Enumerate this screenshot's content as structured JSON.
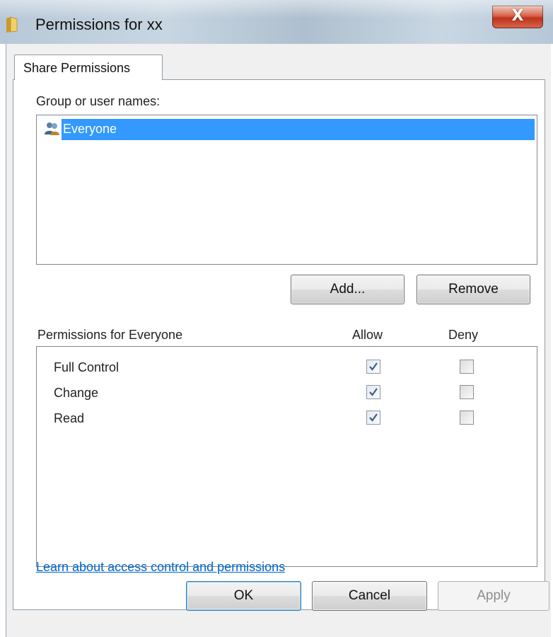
{
  "window": {
    "title": "Permissions for xx",
    "icon": "folder-icon",
    "close_icon": "close-icon",
    "close_label": "X"
  },
  "tabs": [
    {
      "label": "Share Permissions",
      "selected": true
    }
  ],
  "group_section": {
    "label": "Group or user names:",
    "items": [
      {
        "name": "Everyone",
        "icon": "users-icon",
        "selected": true
      }
    ],
    "add_label": "Add...",
    "remove_label": "Remove"
  },
  "permissions_section": {
    "label": "Permissions for Everyone",
    "allow_header": "Allow",
    "deny_header": "Deny",
    "rows": [
      {
        "name": "Full Control",
        "allow": true,
        "deny": false
      },
      {
        "name": "Change",
        "allow": true,
        "deny": false
      },
      {
        "name": "Read",
        "allow": true,
        "deny": false
      }
    ]
  },
  "learn_link": "Learn about access control and permissions",
  "footer": {
    "ok_label": "OK",
    "cancel_label": "Cancel",
    "apply_label": "Apply",
    "apply_enabled": false
  },
  "colors": {
    "selection": "#3399ff",
    "link": "#0066cc",
    "close_button": "#c8432a"
  }
}
